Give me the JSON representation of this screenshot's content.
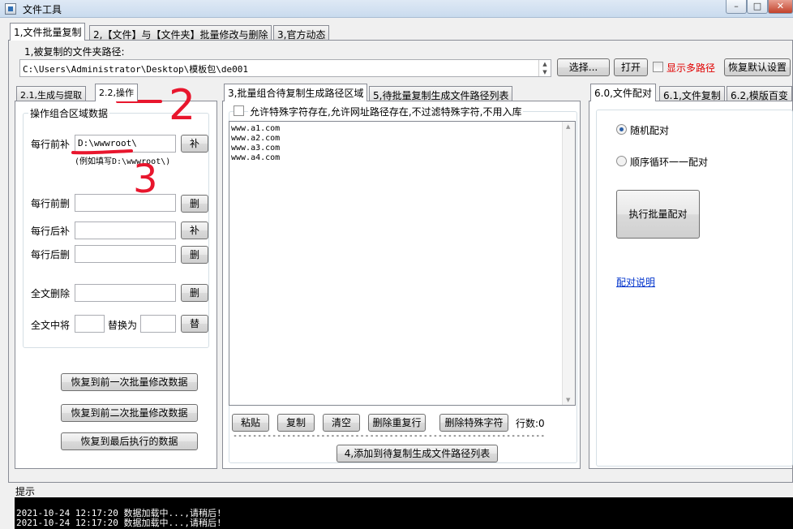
{
  "window": {
    "title": "文件工具"
  },
  "top_tabs": [
    "1,文件批量复制",
    "2,【文件】与【文件夹】批量修改与删除",
    "3,官方动态"
  ],
  "source": {
    "label": "1,被复制的文件夹路径:",
    "path": "C:\\Users\\Administrator\\Desktop\\模板包\\de001",
    "browse_button": "选择...",
    "open_button": "打开",
    "multi_path_label": "显示多路径",
    "restore_button": "恢复默认设置"
  },
  "left_tabs": [
    "2.1,生成与提取",
    "2.2,操作"
  ],
  "ops": {
    "group_title": "操作组合区域数据",
    "prefix_add_label": "每行前补",
    "prefix_add_value": "D:\\wwwroot\\",
    "prefix_add_button": "补",
    "prefix_hint": "(例如填写D:\\wwwroot\\)",
    "prefix_del_label": "每行前删",
    "prefix_del_button": "删",
    "suffix_add_label": "每行后补",
    "suffix_add_button": "补",
    "suffix_del_label": "每行后删",
    "suffix_del_button": "删",
    "all_del_label": "全文删除",
    "all_del_button": "删",
    "replace_label": "全文中将",
    "replace_with_label": "替换为",
    "replace_button": "替",
    "restore1": "恢复到前一次批量修改数据",
    "restore2": "恢复到前二次批量修改数据",
    "restore3": "恢复到最后执行的数据"
  },
  "annotations": {
    "two": "2",
    "three": "3"
  },
  "middle_tabs": [
    "3,批量组合待复制生成路径区域",
    "5,待批量复制生成文件路径列表"
  ],
  "middle": {
    "allow_special_label": "允许特殊字符存在,允许网址路径存在,不过滤特殊字符,不用入库",
    "lines": [
      "www.a1.com",
      "www.a2.com",
      "www.a3.com",
      "www.a4.com"
    ],
    "paste_button": "粘贴",
    "copy_button": "复制",
    "clear_button": "清空",
    "dedupe_button": "删除重复行",
    "strip_special_button": "删除特殊字符",
    "line_count": "行数:0",
    "dashes": "----------------------------------------------------------------",
    "add_button": "4,添加到待复制生成文件路径列表"
  },
  "right_tabs": [
    "6.0,文件配对",
    "6.1,文件复制",
    "6.2,模版百变"
  ],
  "right": {
    "random_label": "随机配对",
    "sequence_label": "顺序循环一一配对",
    "execute_button": "执行批量配对",
    "help_link": "配对说明"
  },
  "log": {
    "label": "提示",
    "lines": [
      "2021-10-24 12:17:20  数据加载中...,请稍后!",
      "2021-10-24 12:17:20  数据加载中...,请稍后!"
    ]
  },
  "colors": {
    "annotation_red": "#e8162d",
    "link_blue": "#0033cc"
  }
}
